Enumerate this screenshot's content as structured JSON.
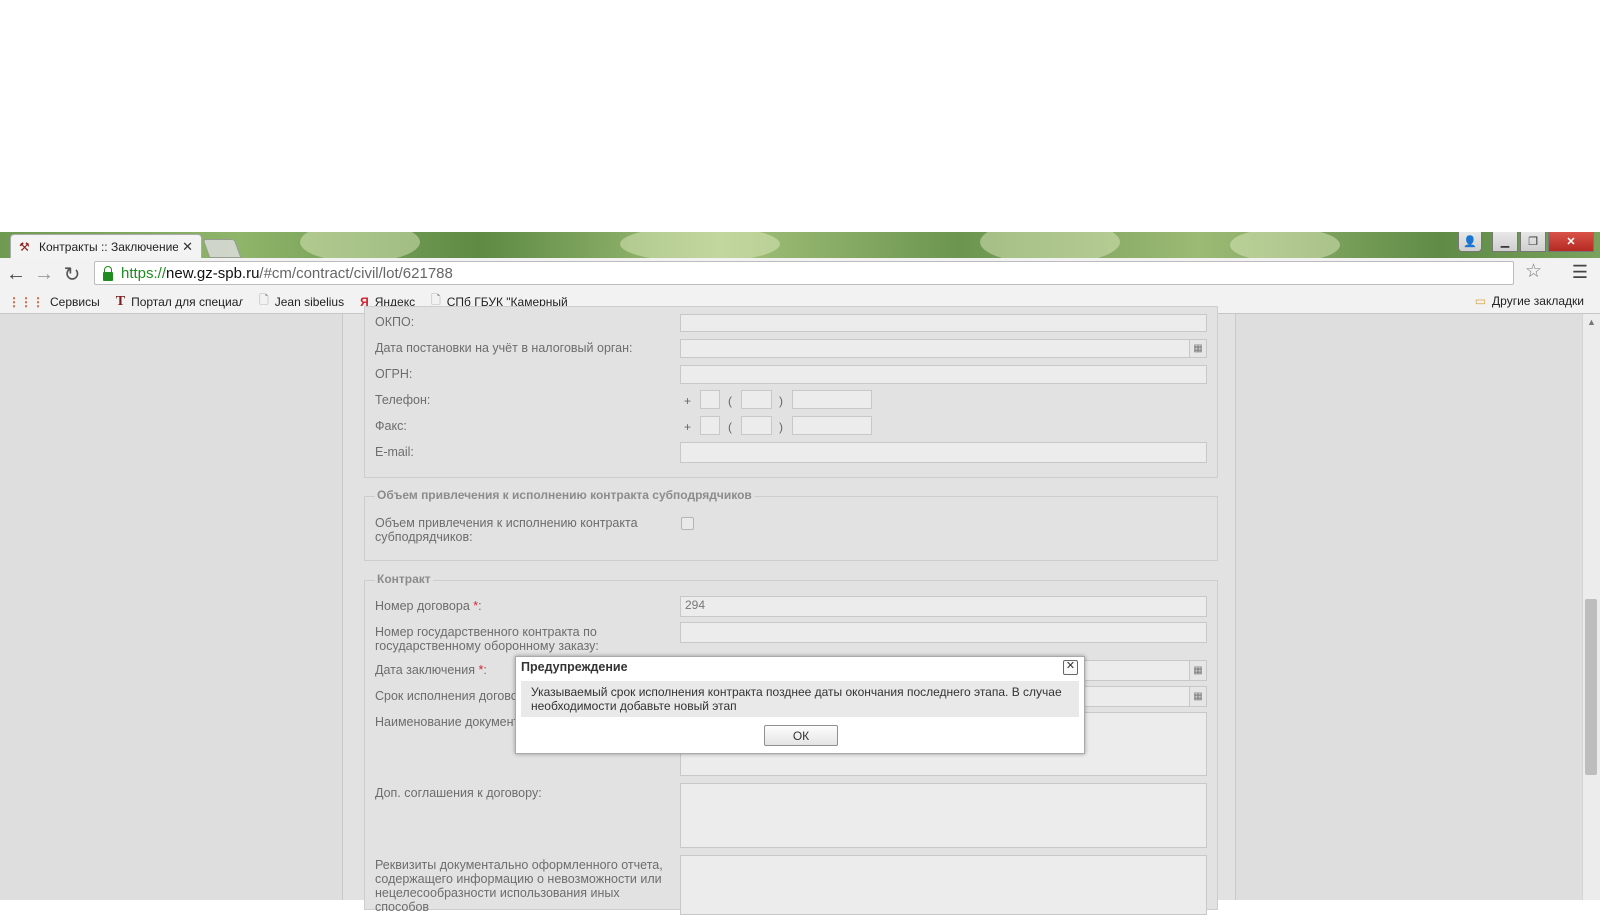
{
  "browser": {
    "tab_title": "Контракты :: Заключение",
    "tab_close": "✕",
    "url_scheme": "https://",
    "url_host": "new.gz-spb.ru",
    "url_path": "/#cm/contract/civil/lot/621788",
    "window_close": "✕"
  },
  "bookmarks": {
    "items": [
      {
        "label": "Сервисы",
        "icon": "apps-icon"
      },
      {
        "label": "Портал для специалистов",
        "icon": "portal-icon"
      },
      {
        "label": "Jean sibelius",
        "icon": "document-icon"
      },
      {
        "label": "Яндекс",
        "icon": "yandex-icon"
      },
      {
        "label": "СПб ГБУК \"Камерный",
        "icon": "document-icon"
      }
    ],
    "other": "Другие закладки"
  },
  "form": {
    "okpo_label": "ОКПО:",
    "tax_date_label": "Дата постановки на учёт в налоговый орган:",
    "ogrn_label": "ОГРН:",
    "phone_label": "Телефон:",
    "fax_label": "Факс:",
    "email_label": "E-mail:",
    "phone_plus": "+",
    "phone_open": "(",
    "phone_close": ")",
    "subcontract_legend": "Объем привлечения к исполнению контракта субподрядчиков",
    "subcontract_label": "Объем привлечения к исполнению контракта субподрядчиков:",
    "contract_legend": "Контракт",
    "contract_number_label": "Номер договора",
    "contract_number_value": "294",
    "required_mark": "*",
    "colon": ":",
    "state_contract_label": "Номер государственного контракта по государственному оборонному заказу:",
    "conclusion_date_label": "Дата заключения",
    "term_label": "Срок исполнения договора",
    "doc_name_label": "Наименование документа",
    "supp_agreements_label": "Доп. соглашения к договору:",
    "report_details_label": "Реквизиты документально оформленного отчета, содержащего информацию о невозможности или нецелесообразности использования иных способов"
  },
  "modal": {
    "title": "Предупреждение",
    "message": "Указываемый срок исполнения контракта позднее даты окончания последнего этапа. В случае необходимости добавьте новый этап",
    "ok_label": "ОК"
  }
}
